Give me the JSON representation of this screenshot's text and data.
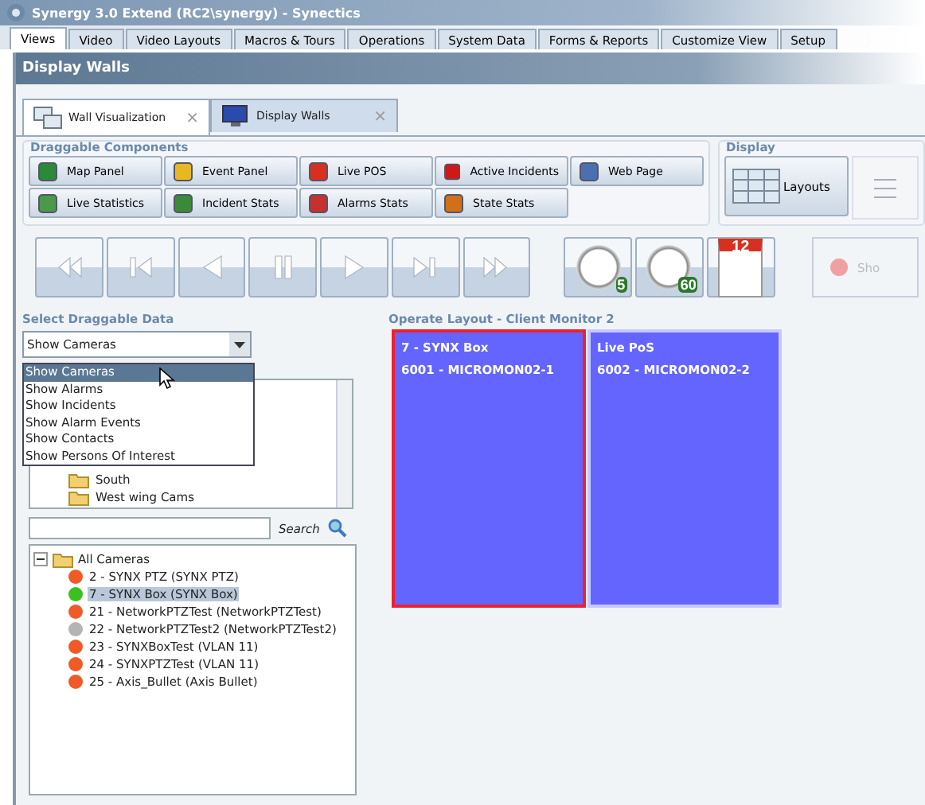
{
  "window": {
    "title": "Synergy 3.0 Extend (RC2\\synergy) - Synectics"
  },
  "menu_tabs": [
    {
      "label": "Views",
      "selected": true
    },
    {
      "label": "Video",
      "selected": false
    },
    {
      "label": "Video Layouts",
      "selected": false
    },
    {
      "label": "Macros & Tours",
      "selected": false
    },
    {
      "label": "Operations",
      "selected": false
    },
    {
      "label": "System Data",
      "selected": false
    },
    {
      "label": "Forms & Reports",
      "selected": false
    },
    {
      "label": "Customize View",
      "selected": false
    },
    {
      "label": "Setup",
      "selected": false
    }
  ],
  "page_title": "Display Walls",
  "doc_tabs": [
    {
      "label": "Wall Visualization",
      "selected": true,
      "close": "×"
    },
    {
      "label": "Display Walls",
      "selected": false,
      "close": "×"
    }
  ],
  "components": {
    "title": "Draggable Components",
    "items": [
      {
        "label": "Map Panel"
      },
      {
        "label": "Event Panel"
      },
      {
        "label": "Live POS"
      },
      {
        "label": "Active Incidents"
      },
      {
        "label": "Web Page"
      },
      {
        "label": "Live Statistics"
      },
      {
        "label": "Incident Stats"
      },
      {
        "label": "Alarms Stats"
      },
      {
        "label": "State Stats"
      }
    ]
  },
  "display": {
    "title": "Display",
    "layouts_button": "Layouts"
  },
  "timers": [
    {
      "kind": "clock",
      "label": "5"
    },
    {
      "kind": "clock",
      "label": "60"
    },
    {
      "kind": "calendar",
      "label": "12"
    }
  ],
  "show_button": "Sho",
  "select_data": {
    "title": "Select Draggable Data",
    "value": "Show Cameras",
    "options": [
      {
        "label": "Show Cameras",
        "selected": true
      },
      {
        "label": "Show Alarms",
        "selected": false
      },
      {
        "label": "Show Incidents",
        "selected": false
      },
      {
        "label": "Show Alarm Events",
        "selected": false
      },
      {
        "label": "Show Contacts",
        "selected": false
      },
      {
        "label": "Show Persons Of Interest",
        "selected": false
      }
    ],
    "tree": [
      {
        "label": "South"
      },
      {
        "label": "West wing Cams"
      }
    ],
    "search_label": "Search"
  },
  "cameras": {
    "root": "All Cameras",
    "expanded": true,
    "items": [
      {
        "label": "2 - SYNX PTZ (SYNX PTZ)",
        "color": "#f05a28",
        "selected": false
      },
      {
        "label": "7 - SYNX Box (SYNX Box)",
        "color": "#3cc020",
        "selected": true
      },
      {
        "label": "21 - NetworkPTZTest (NetworkPTZTest)",
        "color": "#f05a28",
        "selected": false
      },
      {
        "label": "22 - NetworkPTZTest2 (NetworkPTZTest2)",
        "color": "#b4b4b4",
        "selected": false
      },
      {
        "label": "23 - SYNXBoxTest (VLAN 11)",
        "color": "#f05a28",
        "selected": false
      },
      {
        "label": "24 - SYNXPTZTest (VLAN 11)",
        "color": "#f05a28",
        "selected": false
      },
      {
        "label": "25 - Axis_Bullet (Axis Bullet)",
        "color": "#f05a28",
        "selected": false
      }
    ]
  },
  "layout": {
    "title": "Operate Layout - Client Monitor 2",
    "tiles": [
      {
        "name": "7 - SYNX Box",
        "monitor": "6001 - MICROMON02-1",
        "selected": true
      },
      {
        "name": "Live PoS",
        "monitor": "6002 - MICROMON02-2",
        "selected": false
      }
    ]
  }
}
